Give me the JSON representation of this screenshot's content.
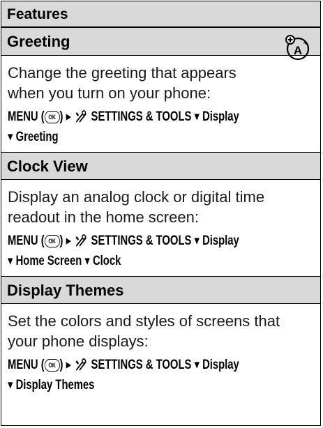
{
  "header": {
    "title": "Features"
  },
  "sections": [
    {
      "title": "Greeting",
      "body": [
        "Change the greeting that appears",
        "when you turn on your phone:"
      ],
      "path_line1": {
        "menu": "MENU",
        "ok": "OK",
        "root": "SETTINGS & TOOLS",
        "item1": "Display"
      },
      "path_line2": [
        "Greeting"
      ]
    },
    {
      "title": "Clock View",
      "body": [
        "Display an analog clock or digital time",
        "readout in the home screen:"
      ],
      "path_line1": {
        "menu": "MENU",
        "ok": "OK",
        "root": "SETTINGS & TOOLS",
        "item1": "Display"
      },
      "path_line2": [
        "Home Screen",
        "Clock"
      ]
    },
    {
      "title": "Display Themes",
      "body": [
        "Set the colors and styles of screens that",
        "your phone displays:"
      ],
      "path_line1": {
        "menu": "MENU",
        "ok": "OK",
        "root": "SETTINGS & TOOLS",
        "item1": "Display"
      },
      "path_line2": [
        "Display Themes"
      ]
    }
  ],
  "icons": {
    "ok_key": "ok-key-icon",
    "tools": "settings-tools-icon",
    "arrow_right": "▸",
    "arrow_down": "▾",
    "badge": "personalize-feature-icon"
  }
}
